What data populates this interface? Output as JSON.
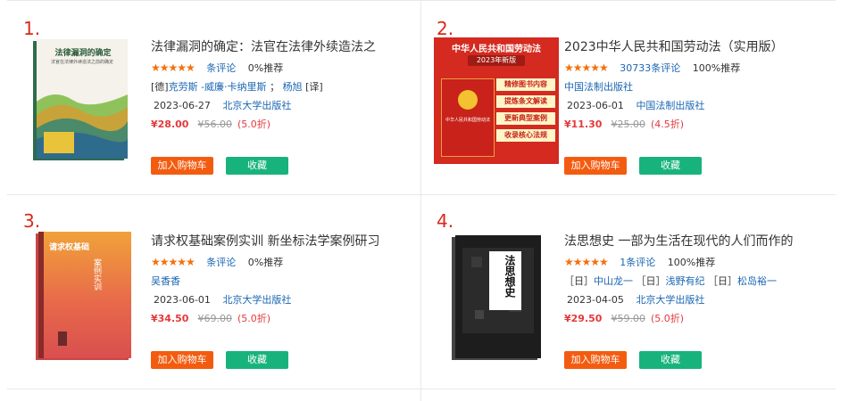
{
  "books": [
    {
      "rank": "1.",
      "title": "法律漏洞的确定：法官在法律外续造法之",
      "stars": "★★★★★",
      "reviews": "条评论",
      "recommend": "0%推荐",
      "authors_prefix": "[德]",
      "authors": "克劳斯 -威廉·卡纳里斯",
      "authors_sep": "；",
      "translator": "杨旭",
      "translator_suffix": "[译]",
      "date": "2023-06-27",
      "publisher": "北京大学出版社",
      "price": "¥28.00",
      "old_price": "¥56.00",
      "discount": "(5.0折)",
      "cover_title": "法律漏洞的确定",
      "cover_sub": "法官在法律外续造法之前的确定"
    },
    {
      "rank": "2.",
      "title": "2023中华人民共和国劳动法（实用版）",
      "stars": "★★★★★",
      "reviews": "30733条评论",
      "recommend": "100%推荐",
      "authors": "中国法制出版社",
      "date": "2023-06-01",
      "publisher": "中国法制出版社",
      "price": "¥11.30",
      "old_price": "¥25.00",
      "discount": "(4.5折)",
      "cover_head": "中华人民共和国劳动法",
      "cover_badge": "2023年新版",
      "cover_tags": [
        "精修图书内容",
        "提炼条文解读",
        "更新典型案例",
        "收录核心法规"
      ],
      "cover_center": "中华人民共和国劳动法"
    },
    {
      "rank": "3.",
      "title": "请求权基础案例实训 新坐标法学案例研习",
      "stars": "★★★★★",
      "reviews": "条评论",
      "recommend": "0%推荐",
      "authors": "吴香香",
      "date": "2023-06-01",
      "publisher": "北京大学出版社",
      "price": "¥34.50",
      "old_price": "¥69.00",
      "discount": "(5.0折)",
      "cover_title": "请求权基础",
      "cover_sub": "案例实训"
    },
    {
      "rank": "4.",
      "title": "法思想史 一部为生活在现代的人们而作的",
      "stars": "★★★★★",
      "reviews": "1条评论",
      "recommend": "100%推荐",
      "a1_prefix": "［日］",
      "a1": "中山龙一",
      "a2_prefix": "［日］",
      "a2": "浅野有纪",
      "a3_prefix": "［日］",
      "a3": "松岛裕一",
      "date": "2023-04-05",
      "publisher": "北京大学出版社",
      "price": "¥29.50",
      "old_price": "¥59.00",
      "discount": "(5.0折)",
      "cover_title": "法思想史"
    }
  ],
  "buttons": {
    "cart": "加入购物车",
    "fav": "收藏"
  },
  "colors": {
    "rank": "#d9291c",
    "star": "#f4700c",
    "link": "#1a66b3",
    "price": "#e4393c",
    "cart": "#f35c10",
    "fav": "#18b37c"
  }
}
